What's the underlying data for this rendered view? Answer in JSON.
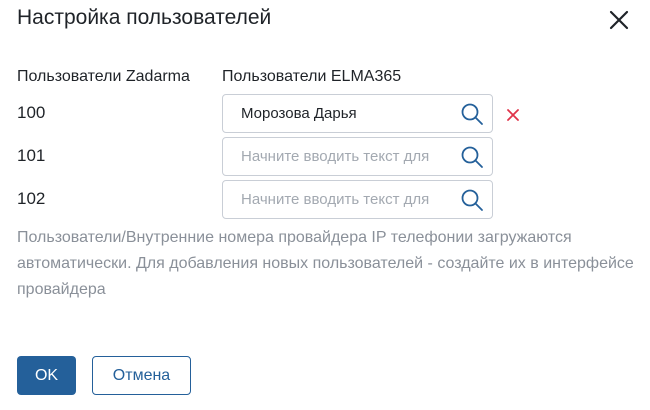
{
  "dialog": {
    "title": "Настройка пользователей",
    "close_icon": "close-icon"
  },
  "columns": {
    "provider_users": "Пользователи Zadarma",
    "elma_users": "Пользователи ELMA365"
  },
  "rows": [
    {
      "number": "100",
      "value": "Морозова Дарья",
      "placeholder": "",
      "has_clear": true
    },
    {
      "number": "101",
      "value": "",
      "placeholder": "Начните вводить текст для",
      "has_clear": false
    },
    {
      "number": "102",
      "value": "",
      "placeholder": "Начните вводить текст для",
      "has_clear": false
    }
  ],
  "hint": "Пользователи/Внутренние номера провайдера IP телефонии загружаются автоматически. Для добавления новых пользователей - создайте их в интерфейсе провайдера",
  "buttons": {
    "ok": "OK",
    "cancel": "Отмена"
  },
  "colors": {
    "primary": "#24609a",
    "clear": "#e0344a",
    "hint_text": "#8a9099"
  },
  "icons": {
    "search": "search-icon",
    "clear": "clear-x-icon",
    "close": "close-icon"
  }
}
